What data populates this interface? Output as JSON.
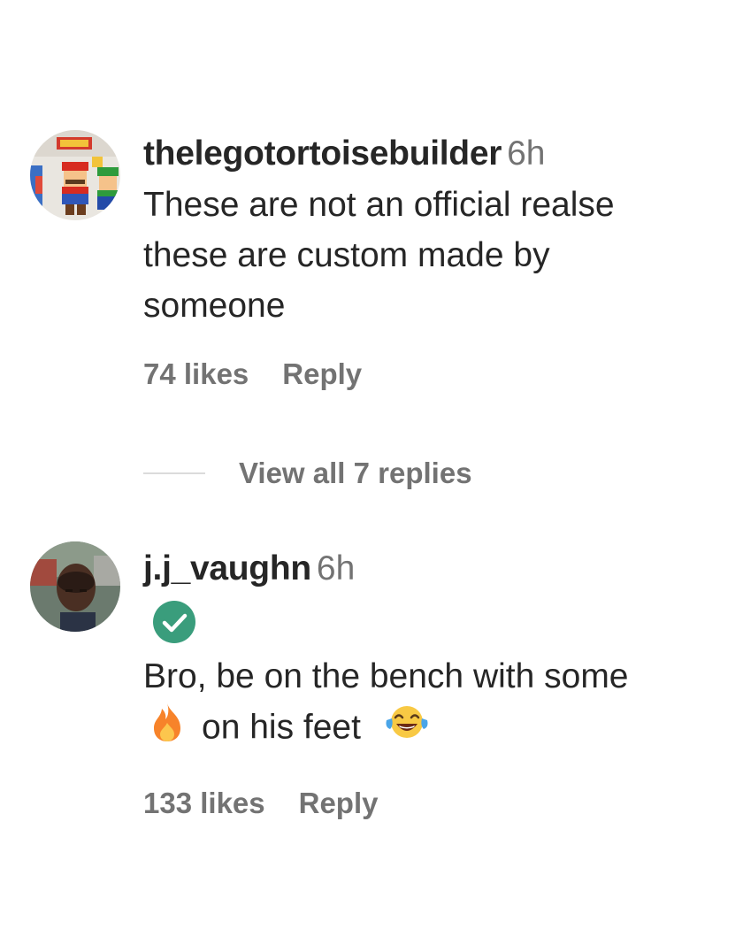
{
  "comments": [
    {
      "username": "thelegotortoisebuilder",
      "time": "6h",
      "text_lines": [
        "These are not an official realse",
        "these are custom made by",
        "someone"
      ],
      "likes": "74 likes",
      "reply": "Reply"
    },
    {
      "username": "j.j_vaughn",
      "time": "6h",
      "verified": true,
      "text_line1": "Bro, be on the bench with some",
      "text_line2": "on his feet",
      "emojis": [
        "fire-emoji",
        "tears-of-joy-emoji"
      ],
      "likes": "133 likes",
      "reply": "Reply"
    }
  ],
  "view_replies": "View all 7 replies",
  "colors": {
    "primary_text": "#262626",
    "secondary_text": "#737373",
    "divider": "#dbdbdb",
    "verified_green": "#3a9d7c"
  }
}
